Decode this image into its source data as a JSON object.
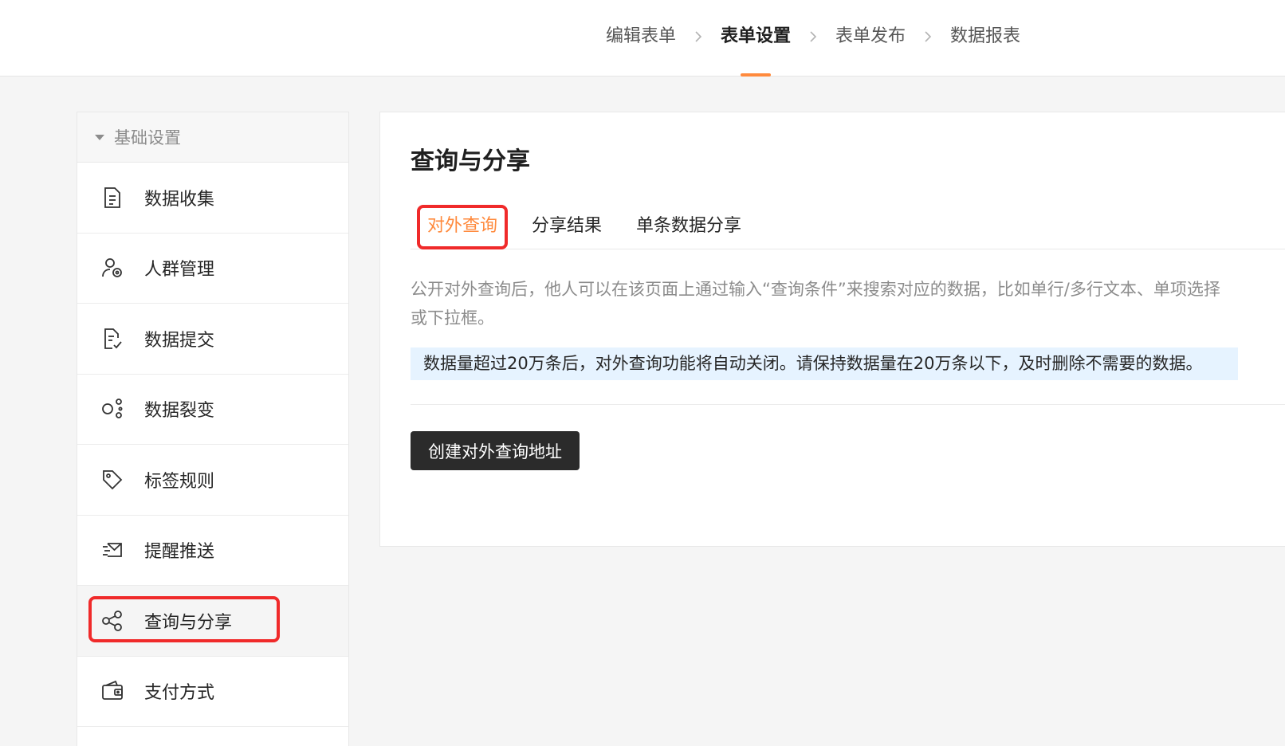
{
  "steps": [
    {
      "label": "编辑表单",
      "active": false
    },
    {
      "label": "表单设置",
      "active": true
    },
    {
      "label": "表单发布",
      "active": false
    },
    {
      "label": "数据报表",
      "active": false
    }
  ],
  "sidebar": {
    "group_label": "基础设置",
    "items": [
      {
        "label": "数据收集",
        "icon": "document-icon"
      },
      {
        "label": "人群管理",
        "icon": "user-settings-icon"
      },
      {
        "label": "数据提交",
        "icon": "document-edit-icon"
      },
      {
        "label": "数据裂变",
        "icon": "fission-icon"
      },
      {
        "label": "标签规则",
        "icon": "tag-icon"
      },
      {
        "label": "提醒推送",
        "icon": "message-push-icon"
      },
      {
        "label": "查询与分享",
        "icon": "share-icon",
        "selected": true
      },
      {
        "label": "支付方式",
        "icon": "wallet-icon"
      }
    ]
  },
  "main": {
    "title": "查询与分享",
    "tabs": [
      {
        "label": "对外查询",
        "active": true
      },
      {
        "label": "分享结果",
        "active": false
      },
      {
        "label": "单条数据分享",
        "active": false
      }
    ],
    "description_line1": "公开对外查询后，他人可以在该页面上通过输入“查询条件”来搜索对应的数据，比如单行/多行文本、单项选择",
    "description_line2": "或下拉框。",
    "notice": "数据量超过20万条后，对外查询功能将自动关闭。请保持数据量在20万条以下，及时删除不需要的数据。",
    "create_button": "创建对外查询地址"
  },
  "colors": {
    "accent": "#ff8a3d",
    "highlight_border": "#f02a2a",
    "notice_bg": "#e6f3ff",
    "primary_button": "#2b2b2b"
  }
}
